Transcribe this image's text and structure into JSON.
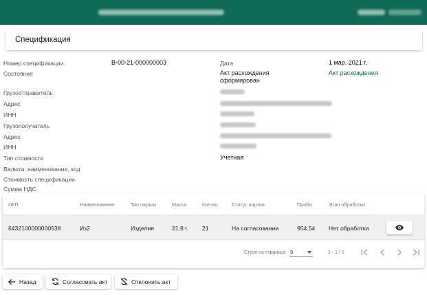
{
  "page": {
    "title": "Спецификация"
  },
  "spec": {
    "number_label": "Номер спецификации",
    "number_value": "В-00-21-000000003",
    "state_label": "Состояние",
    "date_label": "Дата",
    "date_value": "1 мар. 2021 г.",
    "status_value": "Акт расхождения сформирован",
    "status_value_line1": "Акт расхождения",
    "status_value_line2": "сформирован",
    "status_link": "Акт расхождения",
    "shipper_label": "Грузоотправитель",
    "address_label": "Адрес",
    "inn_label": "ИНН",
    "consignee_label": "Грузополучатель",
    "address2_label": "Адрес",
    "inn2_label": "ИНН",
    "cost_type_label": "Тип стоимости",
    "cost_type_value": "Учетная",
    "currency_label": "Валюта: наименование, код",
    "spec_cost_label": "Стоимость спецификации",
    "vat_label": "Сумма НДС"
  },
  "table": {
    "columns": [
      "ИКП",
      "Наименование",
      "Тип партии",
      "Масса",
      "Кол-во",
      "Статус партии",
      "Проба",
      "Этап обработки"
    ],
    "rows": [
      {
        "ikp": "6432100000000538",
        "name": "Из2",
        "type": "Изделия",
        "mass": "21.8 г.",
        "qty": "21",
        "status": "На согласовании",
        "probe": "954.54",
        "stage": "Нет обработки"
      }
    ],
    "row_action_icon": "eye-icon"
  },
  "pagination": {
    "rows_per_page_label": "Строк на странице",
    "rows_per_page_value": "5",
    "range": "1 - 1 / 1"
  },
  "actions": {
    "back": "Назад",
    "approve": "Согласовать акт",
    "reject": "Отклонить акт"
  },
  "colors": {
    "header_bg": "#0f6b57",
    "accent": "#0f6b57"
  }
}
